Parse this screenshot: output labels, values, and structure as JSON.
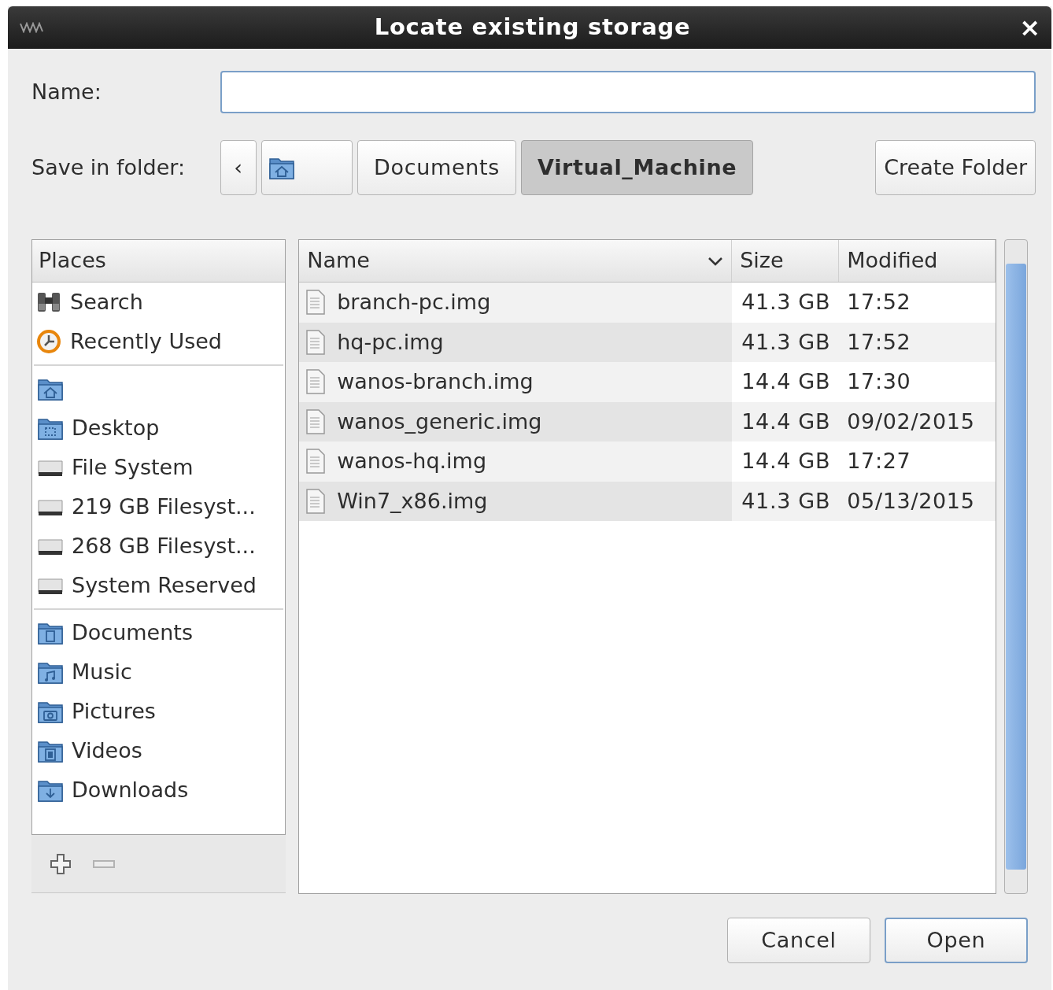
{
  "window": {
    "title": "Locate existing storage",
    "close": "×"
  },
  "name_label": "Name:",
  "folder_label": "Save in folder:",
  "path_bar": [
    {
      "kind": "back",
      "label": "‹",
      "selected": false
    },
    {
      "kind": "home",
      "selected": false
    },
    {
      "kind": "folder",
      "label": "Documents",
      "selected": false
    },
    {
      "kind": "folder",
      "label": "Virtual_Machine",
      "selected": true
    }
  ],
  "create_folder": "Create Folder",
  "places": {
    "title": "Places",
    "groups": [
      [
        {
          "kind": "search",
          "label": "Search"
        },
        {
          "kind": "recent",
          "label": "Recently Used"
        }
      ],
      [
        {
          "kind": "home"
        },
        {
          "kind": "desktop",
          "label": "Desktop"
        },
        {
          "kind": "drive",
          "label": "File System"
        },
        {
          "kind": "drive",
          "label": "219 GB Filesyst..."
        },
        {
          "kind": "drive",
          "label": "268 GB Filesyst..."
        },
        {
          "kind": "drive",
          "label": "System Reserved"
        }
      ],
      [
        {
          "kind": "documents",
          "label": "Documents"
        },
        {
          "kind": "music",
          "label": "Music"
        },
        {
          "kind": "pictures",
          "label": "Pictures"
        },
        {
          "kind": "videos",
          "label": "Videos"
        },
        {
          "kind": "downloads",
          "label": "Downloads"
        }
      ]
    ],
    "add_disabled": false,
    "remove_disabled": true
  },
  "files": {
    "columns": [
      {
        "label": "Name",
        "sorted": true
      },
      {
        "label": "Size",
        "sorted": false
      },
      {
        "label": "Modified",
        "sorted": false
      }
    ],
    "rows": [
      {
        "name": "branch-pc.img",
        "size": "41.3 GB",
        "modified": "17:52"
      },
      {
        "name": "hq-pc.img",
        "size": "41.3 GB",
        "modified": "17:52"
      },
      {
        "name": "wanos-branch.img",
        "size": "14.4 GB",
        "modified": "17:30"
      },
      {
        "name": "wanos_generic.img",
        "size": "14.4 GB",
        "modified": "09/02/2015"
      },
      {
        "name": "wanos-hq.img",
        "size": "14.4 GB",
        "modified": "17:27"
      },
      {
        "name": "Win7_x86.img",
        "size": "41.3 GB",
        "modified": "05/13/2015"
      }
    ]
  },
  "buttons": [
    {
      "label": "Cancel",
      "default": false
    },
    {
      "label": "Open",
      "default": true
    }
  ]
}
